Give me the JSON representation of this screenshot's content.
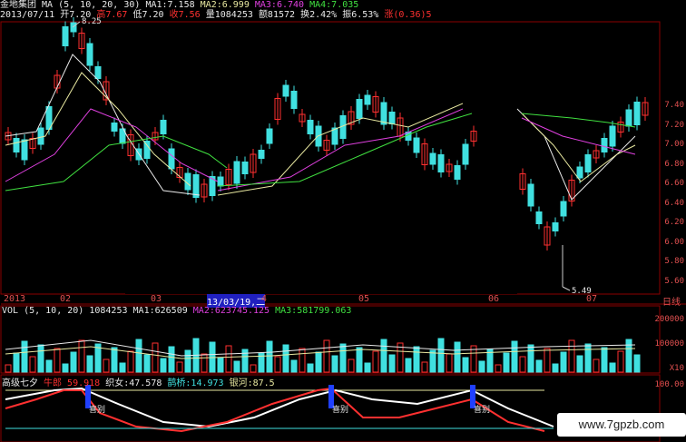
{
  "header": {
    "stock": "金地集团",
    "ma_label": "MA (5, 10, 20, 30)",
    "ma1": "MA1:7.158",
    "ma2": "MA2:6.999",
    "ma3": "MA3:6.740",
    "ma4": "MA4:7.035",
    "date": "2013/07/11",
    "open": "开7.20",
    "high": "高7.67",
    "low": "低7.20",
    "close": "收7.56",
    "vol": "量1084253",
    "amount": "额81572",
    "turnover": "换2.42%",
    "amplitude": "振6.53%",
    "change": "涨(0.36)5"
  },
  "price_axis": {
    "ticks": [
      "7.40",
      "7.20",
      "7.00",
      "6.80",
      "6.60",
      "6.40",
      "6.20",
      "6.00",
      "5.80",
      "5.60"
    ]
  },
  "annotations": {
    "high": "8.25",
    "low": "5.49",
    "cursor_date": "13/03/19,二"
  },
  "time_axis": {
    "labels": [
      "2013",
      "02",
      "03",
      "4",
      "05",
      "06",
      "07"
    ],
    "right_label": "日线"
  },
  "volume_panel": {
    "title": "VOL (5, 10, 20)",
    "value": "1084253",
    "ma1": "MA1:626509",
    "ma2": "MA2:623745.125",
    "ma3": "MA3:581799.063",
    "ticks": [
      "200000",
      "100000"
    ],
    "unit": "X10"
  },
  "indicator_panel": {
    "title": "高级七夕",
    "niulang": "牛郎 59.918",
    "zhinv": "织女:47.578",
    "queqiao": "鹊桥:14.973",
    "yinhe": "银河:87.5",
    "tick": "100.00",
    "markers": [
      "喜别",
      "喜别",
      "喜别"
    ]
  },
  "watermark": "www.7gpzb.com"
}
